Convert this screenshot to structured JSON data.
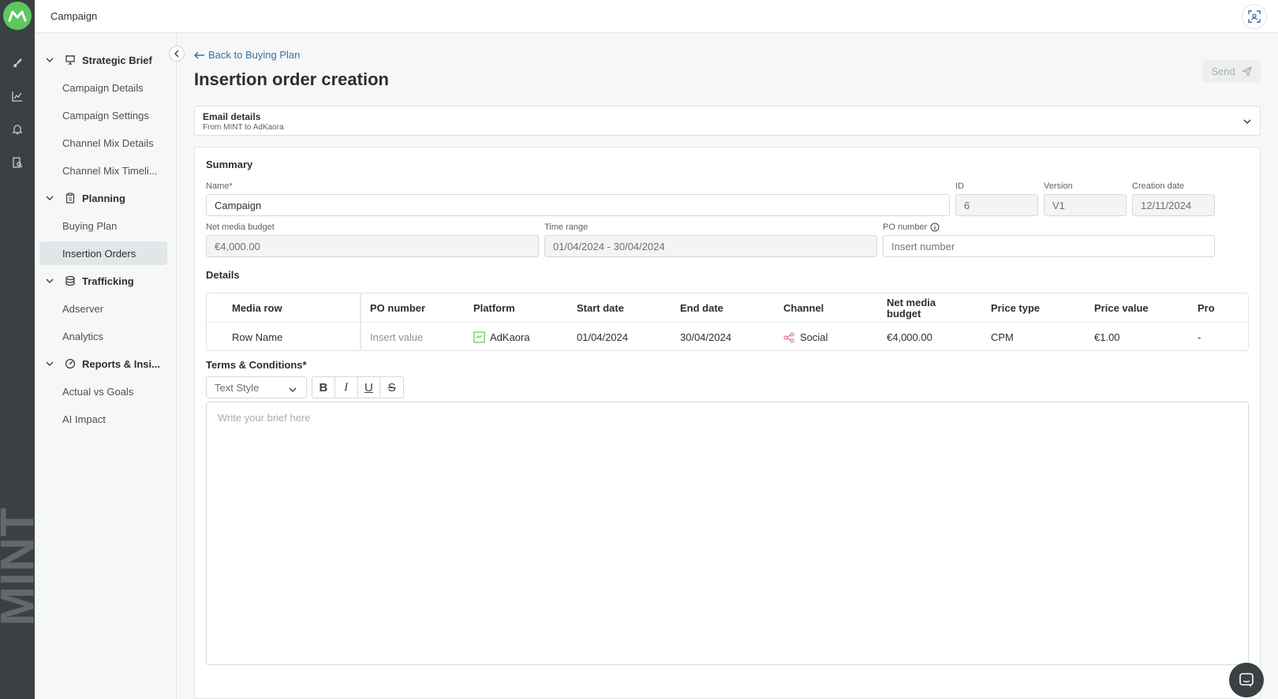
{
  "topbar": {
    "title": "Campaign"
  },
  "rail": {
    "brand": "MINT",
    "icons": [
      "rocket-icon",
      "chart-line-icon",
      "bell-icon",
      "report-icon"
    ]
  },
  "sidebar": {
    "groups": [
      {
        "label": "Strategic Brief",
        "icon": "presentation-icon",
        "items": [
          "Campaign Details",
          "Campaign Settings",
          "Channel Mix Details",
          "Channel Mix Timeli..."
        ]
      },
      {
        "label": "Planning",
        "icon": "clipboard-icon",
        "items": [
          "Buying Plan",
          "Insertion Orders"
        ]
      },
      {
        "label": "Trafficking",
        "icon": "database-icon",
        "items": [
          "Adserver",
          "Analytics"
        ]
      },
      {
        "label": "Reports & Insi...",
        "icon": "gauge-icon",
        "items": [
          "Actual vs Goals",
          "AI Impact"
        ]
      }
    ],
    "active_item": "Insertion Orders"
  },
  "header": {
    "back_label": "Back to Buying Plan",
    "title": "Insertion order creation",
    "send_label": "Send"
  },
  "email": {
    "title": "Email details",
    "subtitle": "From MINT to AdKaora"
  },
  "summary": {
    "title": "Summary",
    "name_label": "Name*",
    "name_value": "Campaign",
    "id_label": "ID",
    "id_value": "6",
    "version_label": "Version",
    "version_value": "V1",
    "creation_label": "Creation date",
    "creation_value": "12/11/2024",
    "budget_label": "Net media budget",
    "budget_value": "€4,000.00",
    "time_label": "Time range",
    "time_value": "01/04/2024 - 30/04/2024",
    "po_label": "PO number",
    "po_placeholder": "Insert number"
  },
  "details": {
    "title": "Details",
    "columns": [
      "Media row",
      "PO number",
      "Platform",
      "Start date",
      "End date",
      "Channel",
      "Net media budget",
      "Price type",
      "Price value",
      "Pro"
    ],
    "row": {
      "media_row": "Row Name",
      "po_placeholder": "Insert value",
      "platform": "AdKaora",
      "start": "01/04/2024",
      "end": "30/04/2024",
      "channel": "Social",
      "budget": "€4,000.00",
      "price_type": "CPM",
      "price_value": "€1.00",
      "pro": "-"
    }
  },
  "terms": {
    "title": "Terms & Conditions*",
    "text_style": "Text Style",
    "format_buttons": [
      "B",
      "I",
      "U",
      "S"
    ],
    "placeholder": "Write your brief here"
  },
  "colors": {
    "accent_green": "#5cc85e",
    "link_blue": "#3a6ea5",
    "rail_dark": "#3b4043",
    "social_pink": "#e05a9c"
  }
}
